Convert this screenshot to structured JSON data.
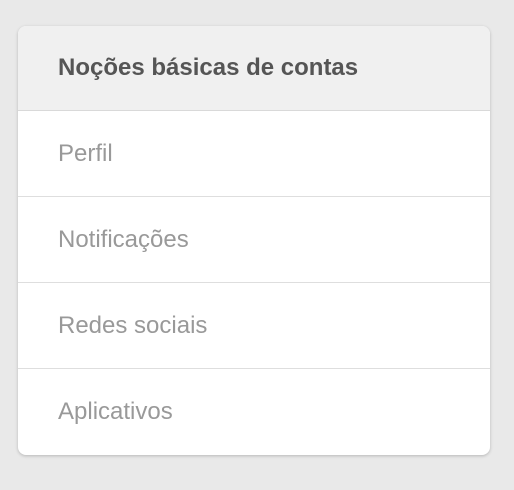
{
  "card": {
    "title": "Noções básicas de contas",
    "items": [
      {
        "label": "Perfil"
      },
      {
        "label": "Notificações"
      },
      {
        "label": "Redes sociais"
      },
      {
        "label": "Aplicativos"
      }
    ]
  },
  "colors": {
    "page_background": "#e9e9e9",
    "card_background": "#ffffff",
    "header_background": "#f0f0f0",
    "title_text": "#555555",
    "item_text": "#999999",
    "divider": "#dedede"
  }
}
